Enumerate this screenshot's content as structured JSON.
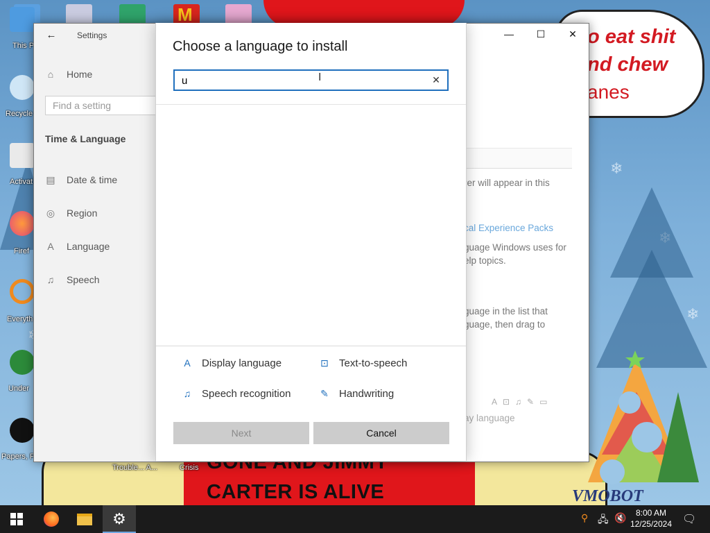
{
  "wallpaper": {
    "meme_lines": [
      "GONE AND JIMMY",
      "CARTER IS ALIVE"
    ],
    "bubble_lines": [
      "o eat shit",
      "nd chew",
      "anes"
    ],
    "signature": "VMOBOT"
  },
  "desktop_icons": [
    {
      "label": "This P",
      "icon": "this-pc-icon"
    },
    {
      "label": "Recycle",
      "icon": "recycle-bin-icon"
    },
    {
      "label": "Activat",
      "icon": "activate-icon"
    },
    {
      "label": "Firef",
      "icon": "firefox-icon"
    },
    {
      "label": "Everyth",
      "icon": "everything-search-icon"
    },
    {
      "label": "Under",
      "icon": "undertale-icon"
    },
    {
      "label": "Papers, F",
      "icon": "papers-please-icon"
    }
  ],
  "bottom_labels": [
    "Trouble... A...",
    "Crisis"
  ],
  "settings": {
    "app_title": "Settings",
    "home_label": "Home",
    "find_placeholder": "Find a setting",
    "section_title": "Time & Language",
    "nav_items": [
      {
        "label": "Date & time",
        "icon": "calendar-clock-icon"
      },
      {
        "label": "Region",
        "icon": "globe-icon"
      },
      {
        "label": "Language",
        "icon": "language-icon"
      },
      {
        "label": "Speech",
        "icon": "microphone-icon"
      }
    ],
    "background_text": {
      "line1": "rer will appear in this",
      "link": "cal Experience Packs",
      "line2": "guage Windows uses for",
      "line3": "elp topics.",
      "line4": "guage in the list that",
      "line5": "guage, then drag to",
      "line6": "ay language"
    }
  },
  "dialog": {
    "title": "Choose a language to install",
    "search_value": "u",
    "features": [
      {
        "label": "Display language",
        "icon": "display-language-icon"
      },
      {
        "label": "Text-to-speech",
        "icon": "text-to-speech-icon"
      },
      {
        "label": "Speech recognition",
        "icon": "speech-recognition-icon"
      },
      {
        "label": "Handwriting",
        "icon": "handwriting-icon"
      }
    ],
    "next_label": "Next",
    "cancel_label": "Cancel"
  },
  "taskbar": {
    "time": "8:00 AM",
    "date": "12/25/2024",
    "apps": [
      "start-icon",
      "firefox-icon",
      "file-explorer-icon",
      "settings-gear-icon"
    ]
  },
  "colors": {
    "accent": "#1f6fbd",
    "taskbar": "#1b1b1b",
    "button_gray": "#cccccc"
  }
}
